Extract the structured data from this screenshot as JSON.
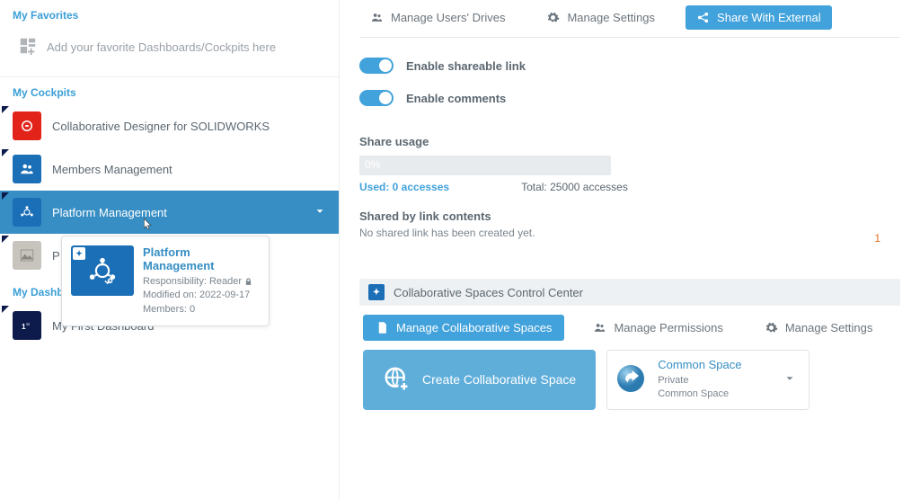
{
  "sidebar": {
    "favorites_label": "My Favorites",
    "favorites_empty": "Add your favorite Dashboards/Cockpits here",
    "cockpits_label": "My Cockpits",
    "cockpits": [
      {
        "label": "Collaborative Designer for SOLIDWORKS"
      },
      {
        "label": "Members Management"
      },
      {
        "label": "Platform Management"
      },
      {
        "label": "P"
      }
    ],
    "dashboards_label": "My Dashboards",
    "dashboards": [
      {
        "label": "My First Dashboard"
      }
    ],
    "tooltip": {
      "title": "Platform Management",
      "responsibility_label": "Responsibility:",
      "responsibility_value": "Reader",
      "modified_label": "Modified on:",
      "modified_value": "2022-09-17",
      "members_label": "Members:",
      "members_value": "0"
    }
  },
  "main": {
    "tabs": {
      "drives": "Manage Users' Drives",
      "settings": "Manage Settings",
      "share": "Share With External"
    },
    "toggles": {
      "link": "Enable shareable link",
      "comments": "Enable comments"
    },
    "share_usage_label": "Share usage",
    "progress_pct": "0%",
    "used_label": "Used: 0 accesses",
    "total_label": "Total: 25000 accesses",
    "shared_contents_label": "Shared by link contents",
    "shared_contents_empty": "No shared link has been created yet.",
    "page_indicator": "1",
    "panel": {
      "title": "Collaborative Spaces Control Center",
      "tabs": {
        "spaces": "Manage Collaborative Spaces",
        "permissions": "Manage Permissions",
        "settings": "Manage Settings"
      },
      "create_label": "Create Collaborative Space",
      "space": {
        "title": "Common Space",
        "privacy": "Private",
        "name": "Common Space"
      }
    }
  }
}
